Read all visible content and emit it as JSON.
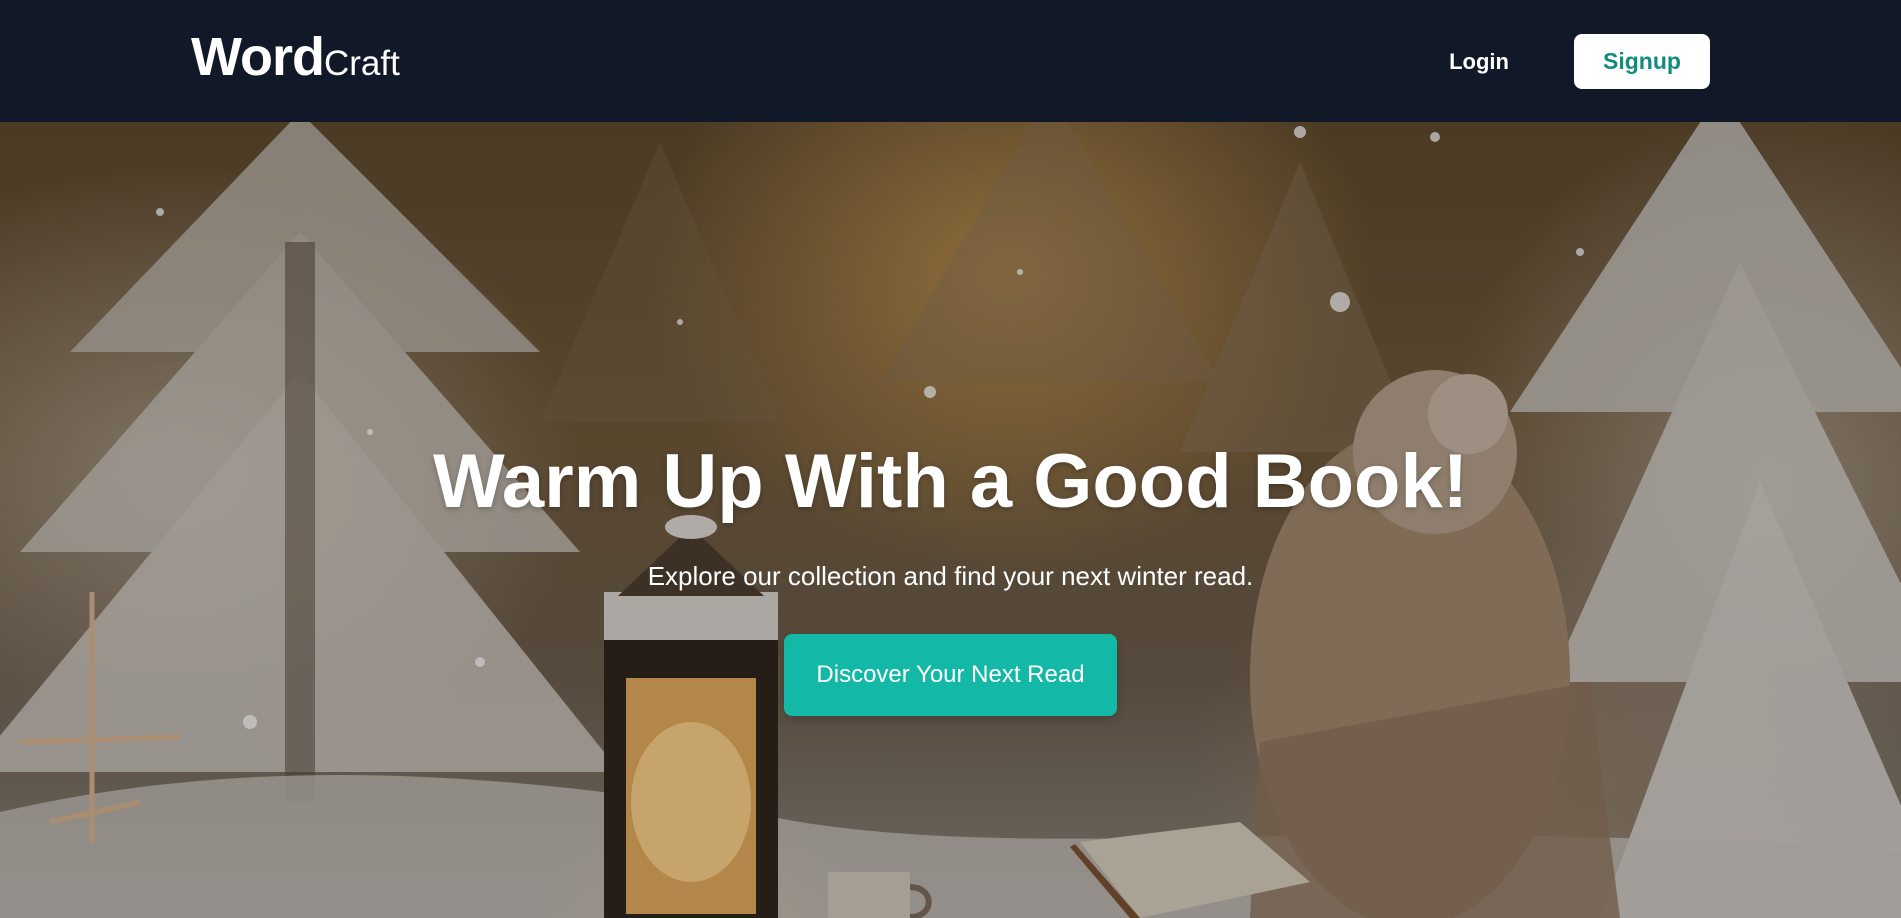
{
  "navbar": {
    "brand_word": "Word",
    "brand_craft": "Craft",
    "login_label": "Login",
    "signup_label": "Signup"
  },
  "hero": {
    "title": "Warm Up With a Good Book!",
    "subtitle": "Explore our collection and find your next winter read.",
    "cta_label": "Discover Your Next Read"
  },
  "colors": {
    "navbar_bg": "#111827",
    "accent": "#14b8a6",
    "signup_text": "#138a80"
  }
}
